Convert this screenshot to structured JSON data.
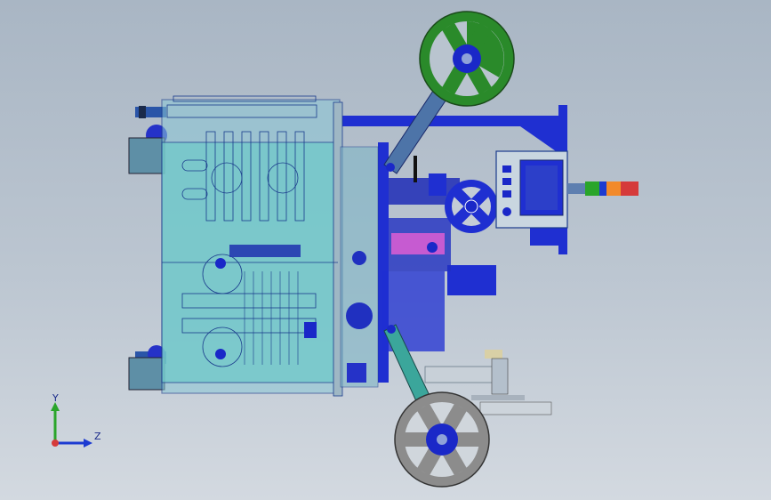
{
  "viewport": {
    "background_top": "#a9b6c4",
    "background_bottom": "#d3d9e0"
  },
  "colors": {
    "housing_fill": "#6fc9c9",
    "housing_stroke": "#1a3b8c",
    "frame_blue": "#1f2fd1",
    "reel_green": "#2a8a2a",
    "reel_gray": "#8c8c8c",
    "hub_blue": "#1a28c8",
    "arm_steel": "#4d74a8",
    "arm_teal": "#3ba69b",
    "panel_gray": "#c9d6e0",
    "magenta": "#c65bd1",
    "light_red": "#d53a3a",
    "light_orange": "#f28a2a",
    "light_green": "#2aa52a",
    "light_blue": "#1d3bd1"
  },
  "triad": {
    "y_label": "Y",
    "z_label": "Z",
    "icon": "coordinate-triad-icon"
  },
  "parts": [
    {
      "name": "machine-housing",
      "icon": "housing-box"
    },
    {
      "name": "top-tape-reel",
      "icon": "reel-green"
    },
    {
      "name": "bottom-tape-reel",
      "icon": "reel-gray"
    },
    {
      "name": "support-frame",
      "icon": "frame-blue"
    },
    {
      "name": "control-panel",
      "icon": "hmi-panel"
    },
    {
      "name": "signal-tower-light",
      "icon": "stack-light"
    }
  ]
}
